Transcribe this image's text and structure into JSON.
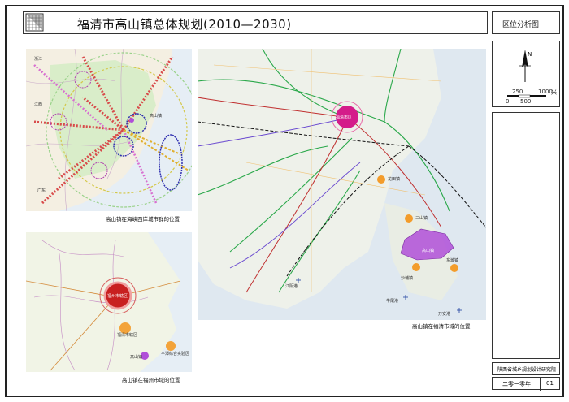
{
  "title": "福清市高山镇总体规划(2010—2030)",
  "sheet_title": "区位分析图",
  "institute": "陕西省城乡规划设计研究院",
  "date": "二零一零年",
  "sheet_no": "01",
  "north_label": "N",
  "scale": {
    "ticks": [
      "0",
      "250",
      "500",
      "1000"
    ],
    "unit": "米"
  },
  "captions": {
    "map1": "高山镇在海峡西岸城市群的位置",
    "map2": "高山镇在福州市域的位置",
    "map3": "高山镇在福清市域的位置"
  },
  "map3_labels": {
    "city": "福清市区",
    "towns": [
      "龙田镇",
      "三山镇",
      "沙埔镇",
      "东瀚镇"
    ],
    "target": "高山镇",
    "ports": [
      "江阴港",
      "牛尾港",
      "万安港"
    ]
  },
  "map2_labels": {
    "city": "福州市辖区",
    "town1": "福清市辖区",
    "target": "高山镇",
    "zone": "平潭综合实验区"
  },
  "map1_labels": {
    "target": "高山镇",
    "regions": [
      "浙江",
      "江西",
      "广东"
    ]
  },
  "colors": {
    "sea": "#dfe8f0",
    "land": "#f2efe6",
    "target_purple": "#b04fd8",
    "city_magenta": "#d41c8a",
    "orange": "#f39c2a",
    "green_road": "#2aa84a",
    "red_circle": "#b02020"
  }
}
